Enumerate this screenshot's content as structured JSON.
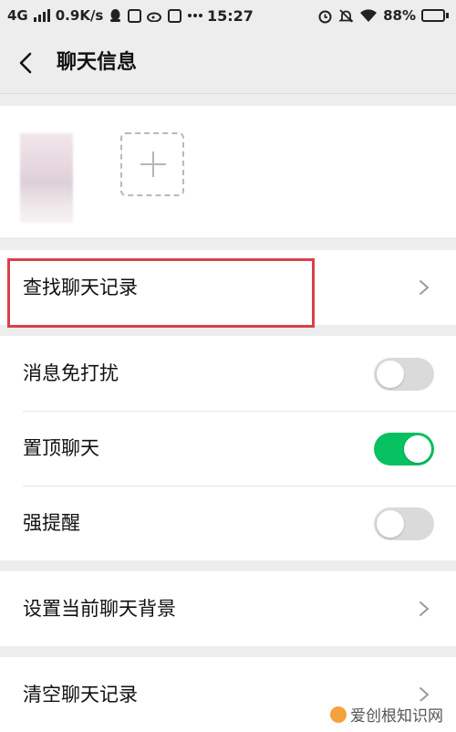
{
  "status_bar": {
    "network": "4G",
    "speed": "0.9K/s",
    "time": "15:27",
    "battery": "88%",
    "battery_level": 0.88
  },
  "header": {
    "title": "聊天信息",
    "back_icon": "chevron-left-icon"
  },
  "members": {
    "add_icon": "plus-icon"
  },
  "rows": {
    "find_history": "查找聊天记录",
    "mute": {
      "label": "消息免打扰",
      "on": false
    },
    "pin": {
      "label": "置顶聊天",
      "on": true
    },
    "strong_remind": {
      "label": "强提醒",
      "on": false
    },
    "set_background": "设置当前聊天背景",
    "clear_history": "清空聊天记录"
  },
  "colors": {
    "accent_green": "#07c160",
    "highlight_red": "#d9414a",
    "background": "#ededed"
  },
  "watermark": {
    "text": "爱创根知识网"
  }
}
